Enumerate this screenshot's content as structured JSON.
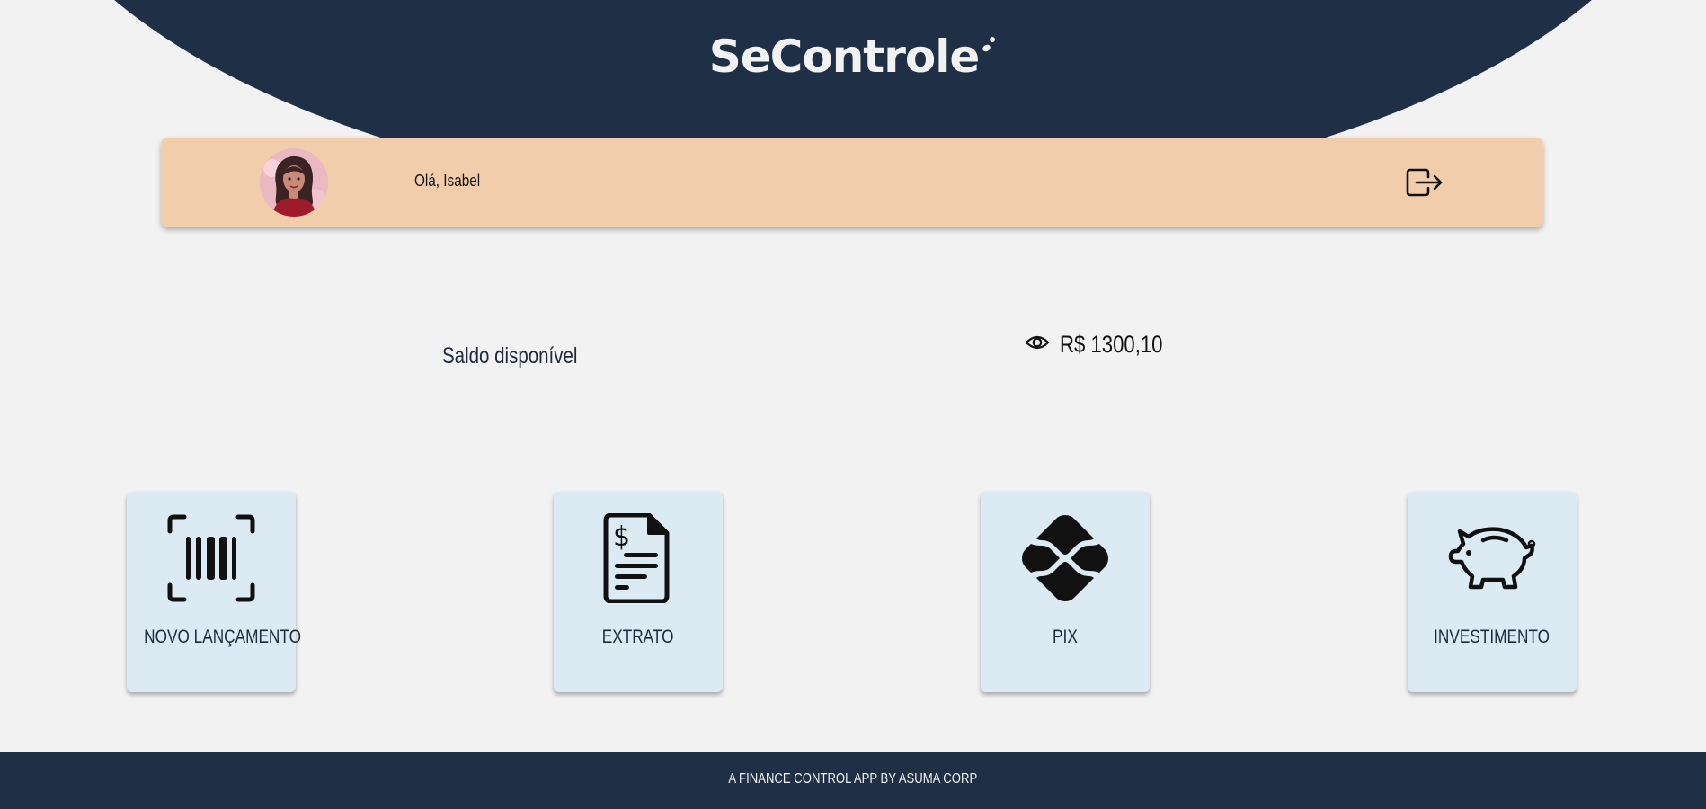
{
  "header": {
    "logo_text": "SeControle"
  },
  "user": {
    "greeting": "Olá, Isabel",
    "avatar_icon": "user-avatar",
    "logout_icon": "logout-icon"
  },
  "balance": {
    "label": "Saldo disponível",
    "value": "R$ 1300,10",
    "visibility_icon": "eye-icon"
  },
  "actions": [
    {
      "label": "NOVO LANÇAMENTO",
      "icon": "barcode-scan-icon"
    },
    {
      "label": "EXTRATO",
      "icon": "invoice-document-icon"
    },
    {
      "label": "PIX",
      "icon": "pix-icon"
    },
    {
      "label": "INVESTIMENTO",
      "icon": "piggy-bank-icon"
    }
  ],
  "footer": {
    "text": "A FINANCE CONTROL APP BY ASUMA CORP"
  },
  "colors": {
    "header_bg": "#1f2f45",
    "user_bar_bg": "#f2cdac",
    "card_bg": "#dbeaf3",
    "page_bg": "#f2f2f2"
  }
}
